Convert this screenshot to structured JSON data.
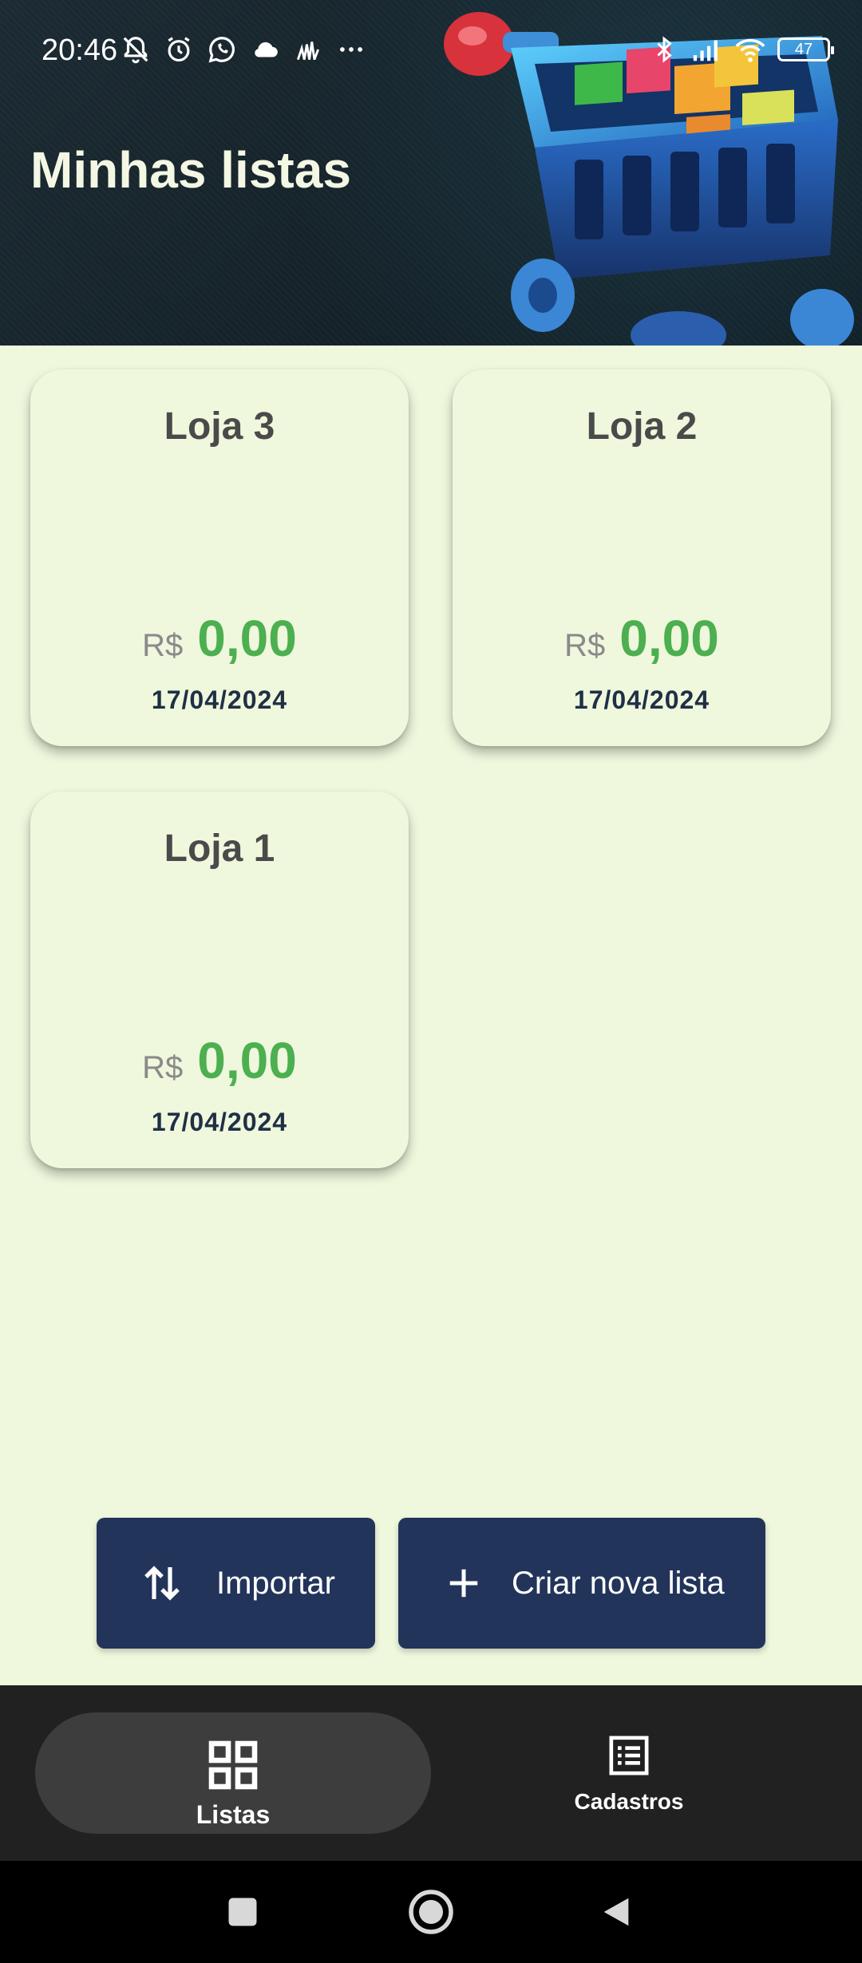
{
  "status_bar": {
    "time": "20:46",
    "left_icons": [
      "muted-bell-icon",
      "alarm-icon",
      "whatsapp-icon",
      "cloud-icon",
      "signal-app-icon",
      "more-dots-icon"
    ],
    "right_icons": [
      "bluetooth-icon",
      "cellular-signal-icon",
      "wifi-icon"
    ],
    "battery_level": "47"
  },
  "header": {
    "title": "Minhas listas"
  },
  "lists": [
    {
      "name": "Loja 3",
      "currency": "R$",
      "total": "0,00",
      "date": "17/04/2024"
    },
    {
      "name": "Loja 2",
      "currency": "R$",
      "total": "0,00",
      "date": "17/04/2024"
    },
    {
      "name": "Loja 1",
      "currency": "R$",
      "total": "0,00",
      "date": "17/04/2024"
    }
  ],
  "actions": {
    "import_label": "Importar",
    "create_label": "Criar nova lista"
  },
  "bottom_nav": {
    "items": [
      {
        "label": "Listas",
        "icon": "grid-icon",
        "active": true
      },
      {
        "label": "Cadastros",
        "icon": "list-icon",
        "active": false
      }
    ]
  },
  "colors": {
    "background": "#eff7dd",
    "header_text": "#f3f7e4",
    "price_green": "#4caf50",
    "date_navy": "#1f3045",
    "button_navy": "#22345a",
    "nav_bar": "#212121",
    "nav_pill": "#3d3d3d"
  }
}
